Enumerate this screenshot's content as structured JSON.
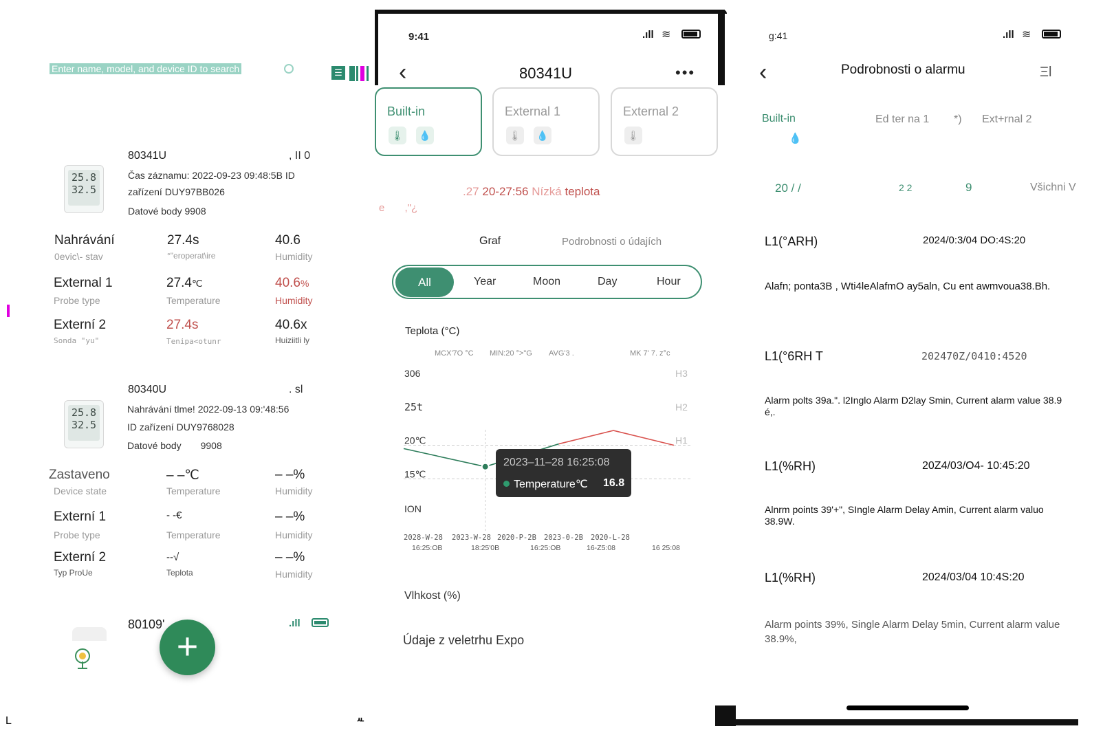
{
  "left": {
    "search_placeholder": "Enter name, model, and device ID to search",
    "top_icon": "list-view-icon",
    "devices": [
      {
        "id": "80341U",
        "signal_text": ", II 0",
        "meta_line1": "Čas záznamu: 2022-09-23 09:48:5B ID",
        "meta_line2": "zařízení DUY97BB026",
        "datapoints_label": "Datové",
        "datapoints_value": "body 9908",
        "lcd_top": "25.8",
        "lcd_bottom": "32.5",
        "rows": [
          {
            "name": "Nahrávání",
            "state_label": "0evic\\- stav",
            "temp": "27.4s",
            "temp_label": "°\"eroperat\\ire",
            "hum": "40.6",
            "hum_label": "Humidity"
          },
          {
            "name": "External 1",
            "state_label": "Probe type",
            "temp": "27.4",
            "temp_unit": "℃",
            "temp_label": "Temperature",
            "hum": "40.6",
            "hum_unit": "%",
            "hum_label": "Humidity"
          },
          {
            "name": "Externí 2",
            "state_label": "Sonda \"yu\"",
            "temp": "27.4s",
            "temp_label": "Tenipa<otunr",
            "hum": "40.6x",
            "hum_label": "Huiziitli ly"
          }
        ]
      },
      {
        "id": "80340U",
        "signal_text": ". sl",
        "meta_line1": "Nahrávání tlme! 2022-09-13 09:'48:56",
        "meta_line2": "ID zařízení DUY9768028",
        "datapoints_label": "Datové body",
        "datapoints_value": "9908",
        "lcd_top": "25.8",
        "lcd_bottom": "32.5",
        "rows": [
          {
            "name": "Zastaveno",
            "state_label": "Device state",
            "temp": "– –℃",
            "temp_label": "Temperature",
            "hum": "– –%",
            "hum_label": "Humidity"
          },
          {
            "name": "Externí 1",
            "state_label": "Probe type",
            "temp": "- -€",
            "temp_label": "Temperature",
            "hum": "– –%",
            "hum_label": "Humidity"
          },
          {
            "name": "Externí 2",
            "state_label": "Typ ProUe",
            "temp": "--√",
            "temp_label": "Teplota",
            "hum": "– –%",
            "hum_label": "Humidity"
          }
        ]
      },
      {
        "id": "80109'"
      }
    ],
    "fab_label": "+",
    "corner_left": "L",
    "corner_mid": "ᄮ"
  },
  "middle": {
    "status_time": "9:41",
    "title": "80341U",
    "more": "•••",
    "back": "‹",
    "probes": [
      {
        "name": "Built-in",
        "icons": [
          "thermometer-icon",
          "droplet-icon"
        ]
      },
      {
        "name": "External 1",
        "icons": [
          "thermometer-icon",
          "droplet-icon"
        ]
      },
      {
        "name": "External 2",
        "icons": [
          "thermometer-icon"
        ]
      }
    ],
    "alarm_prefix": ".27",
    "alarm_time": "20-27:56",
    "alarm_text_a": "Nízká",
    "alarm_text_b": "teplota",
    "alarm_sub": "e       ,\"¿",
    "tab_graph": "Graf",
    "tab_details": "Podrobnosti o údajích",
    "ranges": [
      "All",
      "Year",
      "Moon",
      "Day",
      "Hour"
    ],
    "section_temp": "Teplota (°C)",
    "section_hum": "Vlhkost (%)",
    "section_expo": "Údaje z veletrhu Expo"
  },
  "chart_data": {
    "type": "line",
    "title": "Teplota (°C)",
    "stats": [
      "MCX'7O °C",
      "MIN:20 °>\"G",
      "AVG'3 .",
      "MK 7' 7. z°c"
    ],
    "y_tick_labels": [
      "306",
      "25t",
      "20℃",
      "15℃",
      "ION"
    ],
    "y_ticks": [
      30,
      25,
      20,
      15,
      10
    ],
    "threshold_labels": [
      "H3",
      "H2",
      "H1"
    ],
    "x_tick_labels": [
      [
        "2028-W-28",
        "16:25:OB"
      ],
      [
        "2023-W-28",
        "18:25'0B"
      ],
      [
        "2020-P-2B",
        "16:25:OB"
      ],
      [
        "2023-0-2B",
        "16-Z5:08"
      ],
      [
        "2020-L-28",
        "16 25:08"
      ]
    ],
    "ylim": [
      10,
      30
    ],
    "series": [
      {
        "color": "#2e7d5b",
        "x": [
          0,
          1.42
        ],
        "y": [
          19.5,
          16.8
        ]
      },
      {
        "color": "#2e7d5b",
        "x": [
          1.42,
          2.7
        ],
        "y": [
          16.8,
          20.2
        ]
      },
      {
        "color": "#d9534f",
        "x": [
          2.7,
          3.65,
          4.7
        ],
        "y": [
          20.2,
          22.2,
          20.0
        ]
      }
    ],
    "tooltip": {
      "time": "2023–11–28 16:25:08",
      "label": "Temperature℃",
      "value": "16.8"
    }
  },
  "right": {
    "status_time": "g:41",
    "title": "Podrobnosti o alarmu",
    "back": "‹",
    "menu": "Ξl",
    "tabs": [
      "Built-in",
      "Ed ter na 1",
      "*)",
      "Ext+rnal 2"
    ],
    "filters": [
      "20 / /",
      "2 2",
      "9",
      "Všichni V"
    ],
    "alarms": [
      {
        "code": "L1(°ARH)",
        "time": "2024/0:3/04 DO:4S:20",
        "desc": "Alafn; ponta3B , Wti4leAlafmO ay5aln, Cu ent awmvoua38.Bh."
      },
      {
        "code": "L1(°6RH T",
        "time": "202470Z/0410:4520",
        "desc": "Alarm polts 39a.\". l2Inglo Alarm D2lay Smin, Current alarm value 38.9 é,."
      },
      {
        "code": "L1(%RH)",
        "time": "20Z4/03/O4- 10:45:20",
        "desc": "Alnrm points 39'+\", SIngle Alarm Delay Amin, Current alarm valuo 38.9W."
      },
      {
        "code": "L1(%RH)",
        "time": "2024/03/04 10:4S:20",
        "desc": "Alarm points 39%,  Single Alarm Delay 5min,  Current alarm value 38.9%,"
      }
    ]
  }
}
